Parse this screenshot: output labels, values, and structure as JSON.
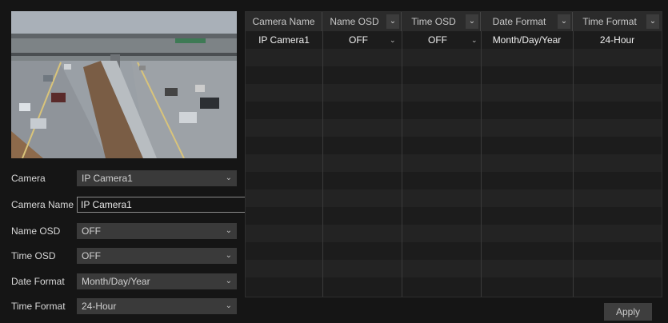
{
  "form": {
    "camera": {
      "label": "Camera",
      "value": "IP Camera1"
    },
    "camera_name": {
      "label": "Camera Name",
      "value": "IP Camera1"
    },
    "name_osd": {
      "label": "Name OSD",
      "value": "OFF"
    },
    "time_osd": {
      "label": "Time OSD",
      "value": "OFF"
    },
    "date_format": {
      "label": "Date Format",
      "value": "Month/Day/Year"
    },
    "time_format": {
      "label": "Time Format",
      "value": "24-Hour"
    }
  },
  "table": {
    "columns": [
      "Camera Name",
      "Name OSD",
      "Time OSD",
      "Date Format",
      "Time Format"
    ],
    "rows": [
      [
        "IP Camera1",
        "OFF",
        "OFF",
        "Month/Day/Year",
        "24-Hour"
      ]
    ]
  },
  "apply_label": "Apply",
  "icons": {
    "dropdown": "chevron-down-icon"
  }
}
